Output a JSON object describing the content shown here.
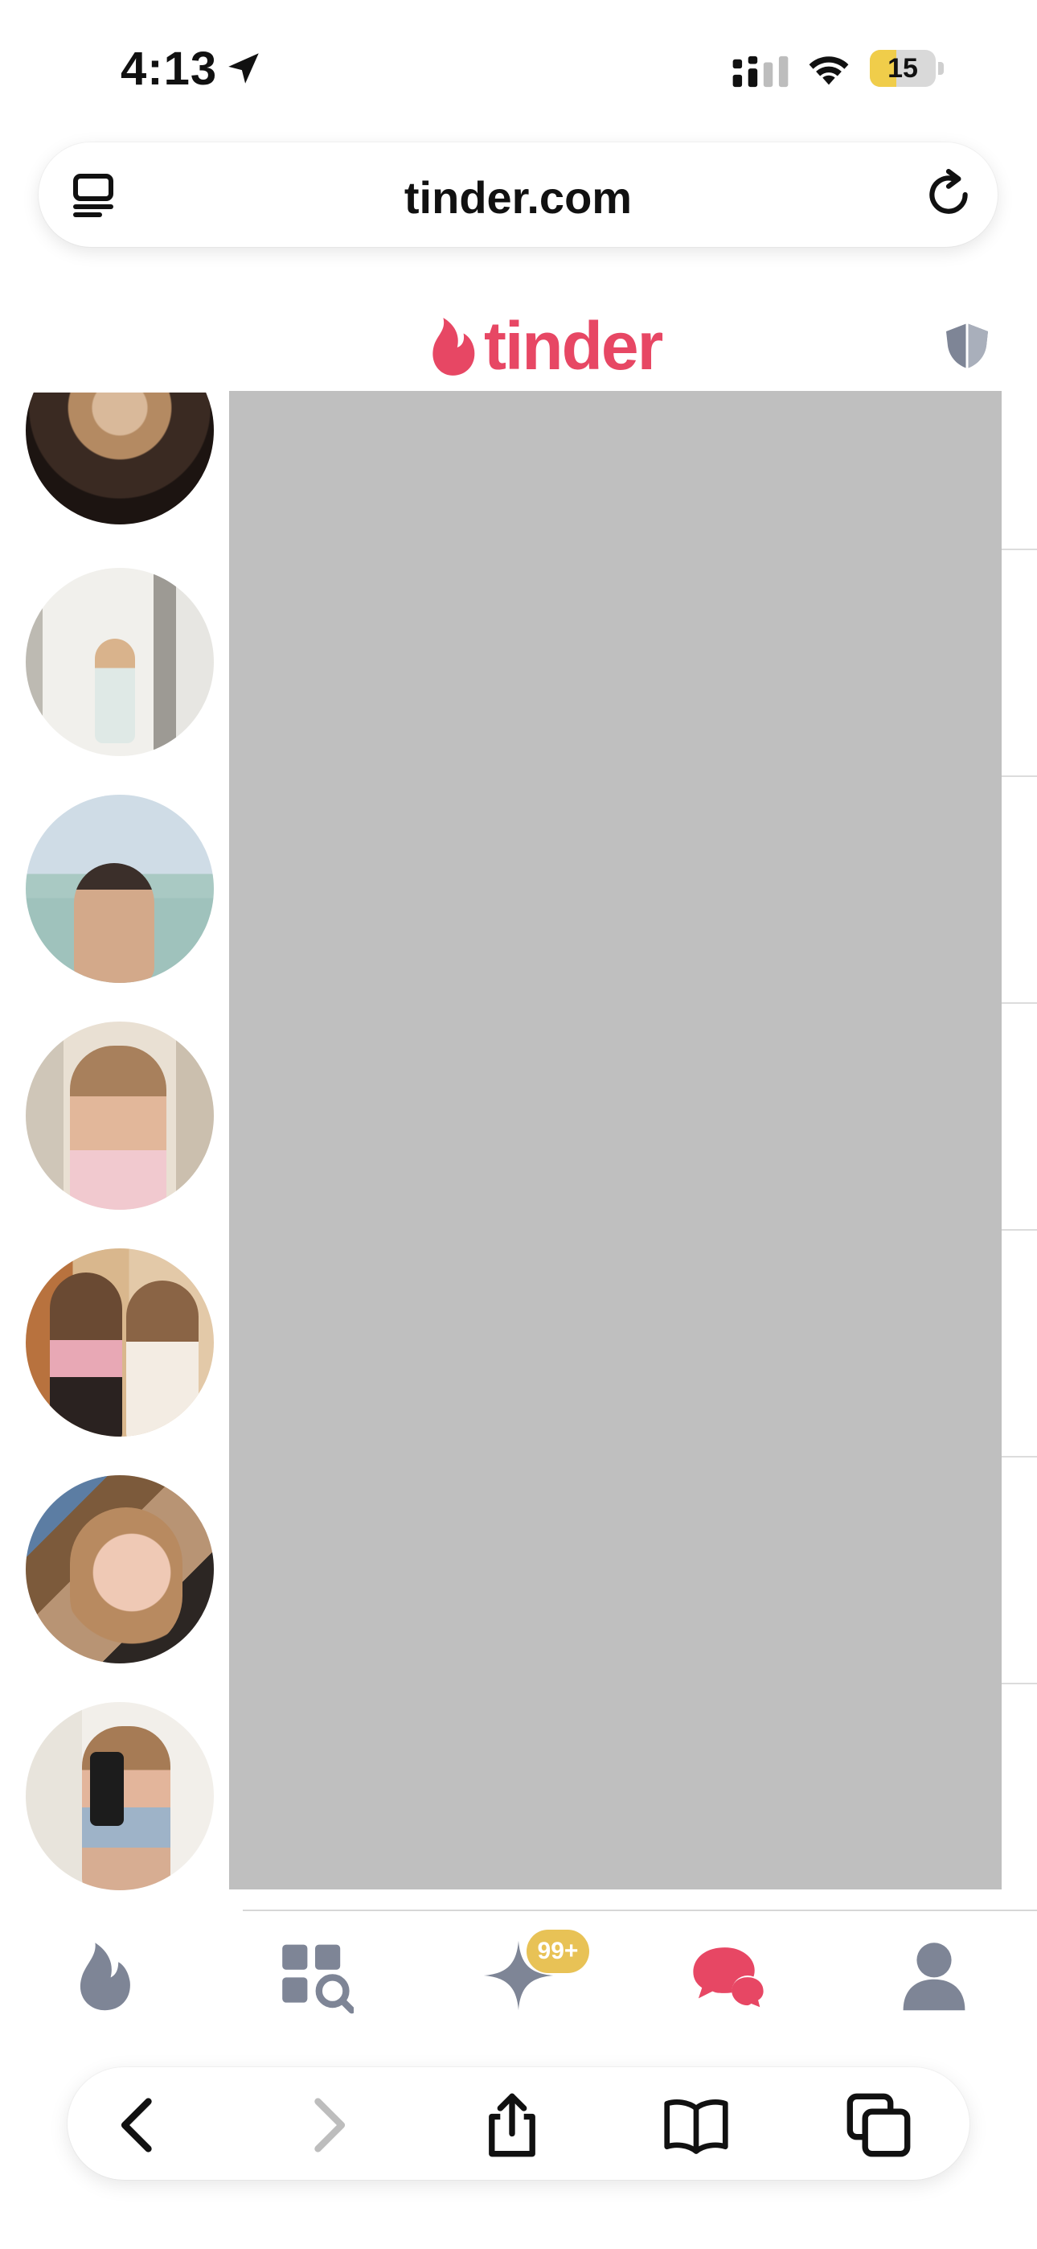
{
  "status_bar": {
    "time": "4:13",
    "battery_level": "15",
    "icons": [
      "location-arrow-icon",
      "cellular-signal-icon",
      "wifi-icon",
      "battery-icon"
    ]
  },
  "browser": {
    "url": "tinder.com",
    "icons": [
      "reader-view-icon",
      "reload-icon"
    ]
  },
  "app": {
    "logo_text": "tinder",
    "brand_color": "#e74764",
    "icons": [
      "tinder-flame-icon",
      "safety-shield-icon"
    ]
  },
  "matches": {
    "avatars": [
      {
        "name": "match-avatar-1"
      },
      {
        "name": "match-avatar-2"
      },
      {
        "name": "match-avatar-3"
      },
      {
        "name": "match-avatar-4"
      },
      {
        "name": "match-avatar-5"
      },
      {
        "name": "match-avatar-6"
      },
      {
        "name": "match-avatar-7"
      }
    ]
  },
  "tinder_nav": {
    "items": [
      "home-flame-icon",
      "explore-icon",
      "likes-sparkle-icon",
      "messages-icon",
      "profile-icon"
    ],
    "likes_badge": "99+",
    "active_item": "messages-icon",
    "active_color": "#e74764",
    "inactive_color": "#7e8596",
    "badge_color": "#e8c256"
  },
  "safari_toolbar": {
    "icons": [
      "back-icon",
      "forward-icon",
      "share-icon",
      "bookmarks-icon",
      "tabs-icon"
    ]
  }
}
